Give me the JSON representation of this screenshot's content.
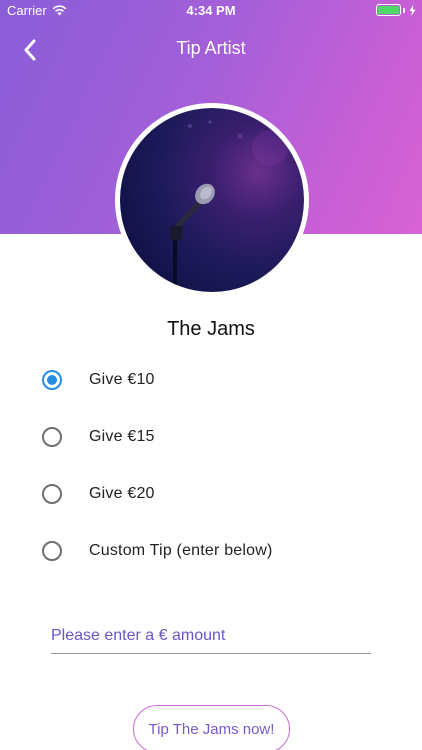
{
  "status_bar": {
    "carrier": "Carrier",
    "time": "4:34 PM",
    "battery_color": "#4cd964"
  },
  "nav": {
    "title": "Tip Artist",
    "back_icon": "chevron-left-icon"
  },
  "artist": {
    "name": "The Jams",
    "avatar_subject": "microphone-on-stage"
  },
  "options": [
    {
      "label": "Give €10",
      "selected": true
    },
    {
      "label": "Give €15",
      "selected": false
    },
    {
      "label": "Give €20",
      "selected": false
    },
    {
      "label": "Custom Tip (enter below)",
      "selected": false
    }
  ],
  "amount": {
    "placeholder": "Please enter a € amount",
    "value": ""
  },
  "submit": {
    "label": "Tip The Jams now!"
  },
  "colors": {
    "gradient_start": "#8a5ed8",
    "gradient_end": "#d862d3",
    "radio_selected": "#2a8be0",
    "accent_text": "#6a55c9"
  }
}
